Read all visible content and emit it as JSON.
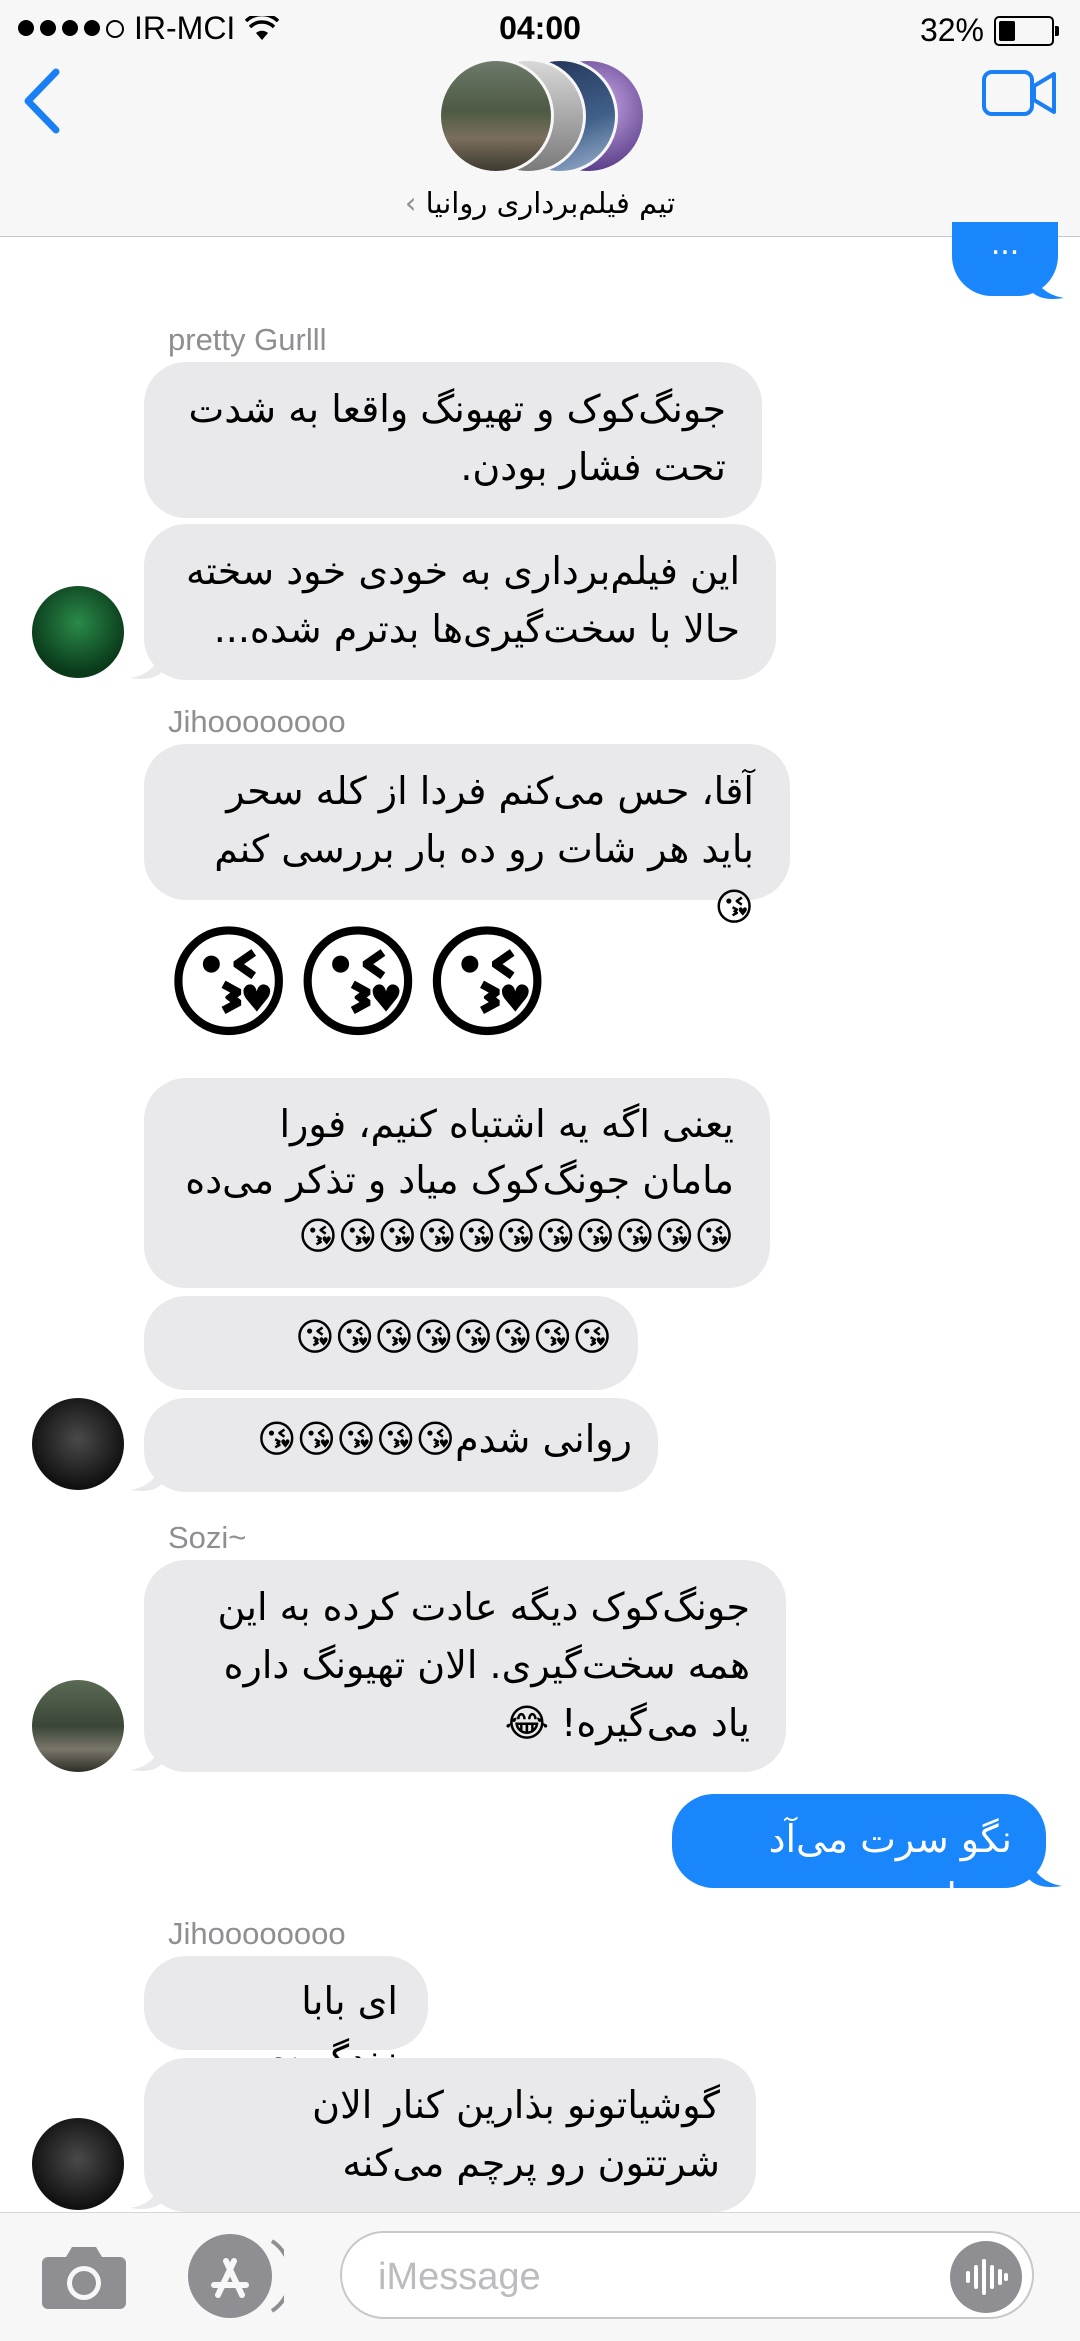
{
  "status": {
    "carrier": "IR-MCI",
    "time": "04:00",
    "battery": "32%",
    "battery_level": 0.32
  },
  "header": {
    "group_name": "تیم فیلم‌برداری روانیا",
    "chevron": "›"
  },
  "top_partial_bubble": "...",
  "messages": [
    {
      "sender": "pretty Gurlll"
    },
    {
      "text": "جونگ‌کوک و تهیونگ واقعا به شدت تحت فشار بودن."
    },
    {
      "text": "این فیلم‌برداری به خودی خود سخته حالا با سخت‌گیری‌ها بدترم شده..."
    },
    {
      "sender": "Jihoooooooo"
    },
    {
      "text": "آقا، حس می‌کنم فردا از کله سحر باید هر شات رو ده بار بررسی کنم😘"
    },
    {
      "text": "😘😘😘"
    },
    {
      "text": "یعنی اگه یه اشتباه کنیم، فورا مامان جونگ‌کوک میاد و تذکر می‌ده😘😘😘😘😘😘😘😘😘😘😘"
    },
    {
      "text": "😘😘😘😘😘😘😘😘"
    },
    {
      "text": "روانی شدم😘😘😘😘😘"
    },
    {
      "sender": "Sozi~"
    },
    {
      "text": "جونگ‌کوک دیگه عادت کرده به این همه سخت‌گیری. الان تهیونگ داره یاد می‌گیره! 😂"
    },
    {
      "text": "نگو سرت می‌آد بخدا"
    },
    {
      "sender": "Jihoooooooo"
    },
    {
      "text": "ای بابا زندگی~"
    },
    {
      "text": "گوشیاتونو بذارین کنار الان شرتتون رو پرچم می‌کنه"
    }
  ],
  "input": {
    "placeholder": "iMessage",
    "value": ""
  },
  "icons": [
    "back-chevron-icon",
    "video-camera-icon",
    "camera-icon",
    "app-store-icon",
    "audio-waveform-icon",
    "wifi-icon",
    "battery-icon"
  ]
}
